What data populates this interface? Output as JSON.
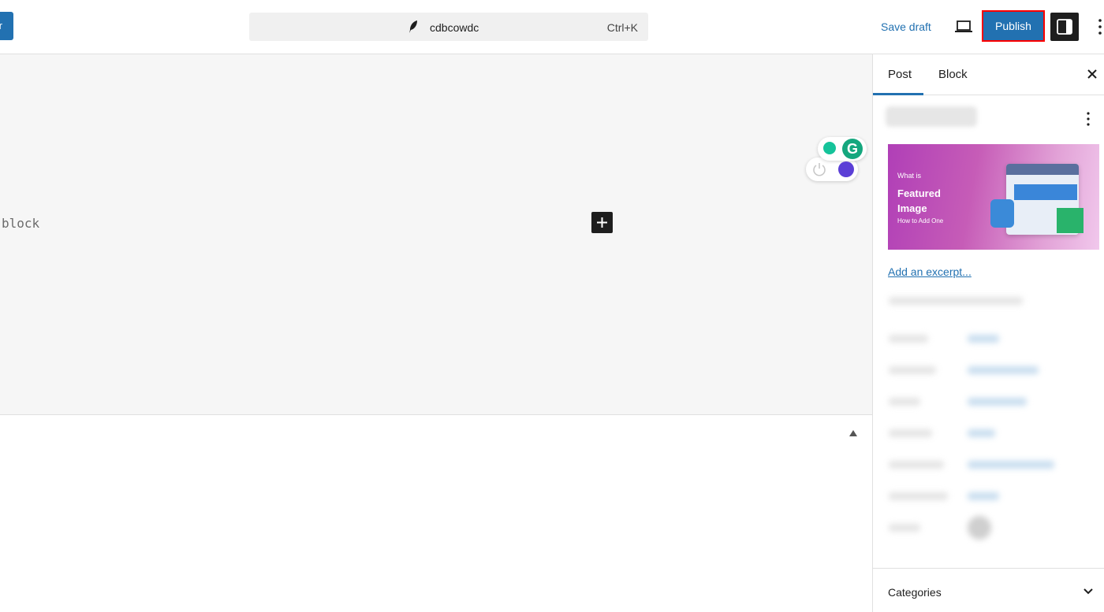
{
  "topbar": {
    "left_button_label": "r",
    "command_bar": {
      "title": "cdbcowdc",
      "shortcut": "Ctrl+K"
    },
    "save_draft_label": "Save draft",
    "publish_label": "Publish"
  },
  "canvas": {
    "block_placeholder": "block"
  },
  "sidebar": {
    "tabs": [
      {
        "label": "Post",
        "active": true
      },
      {
        "label": "Block",
        "active": false
      }
    ],
    "featured_image": {
      "small_text": "What is",
      "line1": "Featured",
      "line2": "Image",
      "subtitle": "How to Add One"
    },
    "excerpt_link": "Add an excerpt...",
    "categories_label": "Categories"
  },
  "colors": {
    "accent": "#2271b1",
    "publish_highlight": "#ff0000",
    "dark_button": "#1e1e1e"
  }
}
